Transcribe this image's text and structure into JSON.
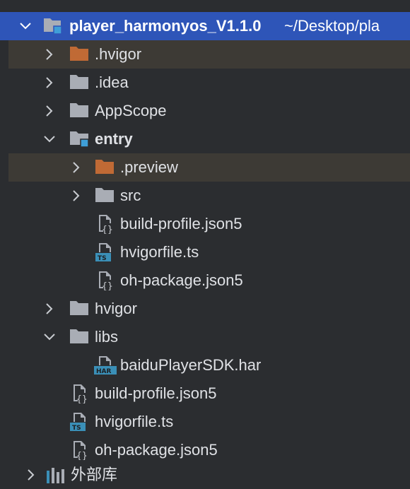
{
  "tree": {
    "root": {
      "name": "player_harmonyos_V1.1.0",
      "path": " ~/Desktop/pla"
    },
    "items": [
      {
        "label": ".hvigor"
      },
      {
        "label": ".idea"
      },
      {
        "label": "AppScope"
      },
      {
        "label": "entry"
      },
      {
        "label": ".preview"
      },
      {
        "label": "src"
      },
      {
        "label": "build-profile.json5"
      },
      {
        "label": "hvigorfile.ts"
      },
      {
        "label": "oh-package.json5"
      },
      {
        "label": "hvigor"
      },
      {
        "label": "libs"
      },
      {
        "label": "baiduPlayerSDK.har"
      },
      {
        "label": "build-profile.json5"
      },
      {
        "label": "hvigorfile.ts"
      },
      {
        "label": "oh-package.json5"
      }
    ],
    "external": {
      "label": "外部库"
    },
    "icon_badges": {
      "ts": "TS",
      "har": "HAR"
    }
  },
  "colors": {
    "selection": "#2e55b8",
    "folder_excluded": "#c06a35",
    "folder_normal": "#a9adb5",
    "module_badge": "#3f9fd8",
    "ts_badge": "#3a8fb7"
  }
}
